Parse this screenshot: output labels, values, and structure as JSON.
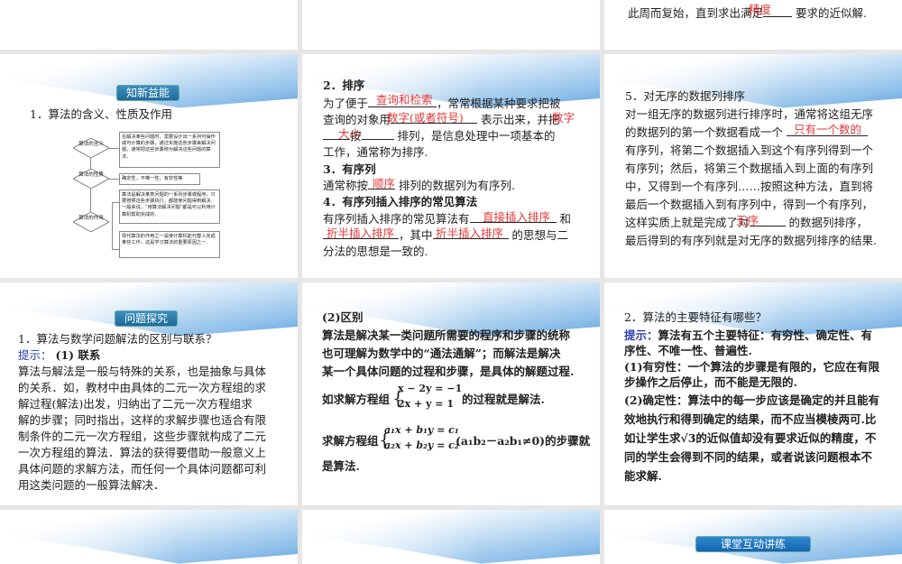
{
  "slides": {
    "top_right": {
      "line": "此周而复始，直到求出满足",
      "line_end": "要求的近似解.",
      "answer": "精度"
    },
    "s1": {
      "badge": "知新益能",
      "heading": "1．算法的含义、性质及作用",
      "diamonds": [
        "算法的含义",
        "算法的性质",
        "算法的作用"
      ],
      "boxes": [
        "在解决某些问题时，需要设计出一系列可操作或可计算的步骤，通过实施这些步骤来解决问题，通常把这些步骤称为解决这些问题的算法．",
        "确定性，不唯一性，有穷性等",
        "算法是解决某类问题的一系列步骤或程序，只要按照这些步骤执行，都能使问题得到解决．一般来说，“用算法解决问题”都是可以利用计算机帮助完成的．",
        "现代算法的作用之一是使计算机能代替人完成某些工作，这是学习算法的重要原因之一．"
      ]
    },
    "s2": {
      "h2": "2．排序",
      "l1a": "为了便于",
      "l1b": "，常常根据某种要求把被",
      "l2a": "查询的对象用",
      "l2b": "表示出来，并把",
      "l3a": "按",
      "l3b": "排列，是信息处理中一项基本的",
      "l4": "工作，通常称为排序.",
      "h3": "3．有序列",
      "l5a": "通常称按",
      "l5b": "排列的数据列为有序列.",
      "h4": "4．有序列插入排序的常见算法",
      "l6a": "有序列插入排序的常见算法有",
      "l6b": "和",
      "l7a": "，其中",
      "l7b": "的思想与二",
      "l8": "分法的思想是一致的.",
      "answers": [
        "查询和检索",
        "数字(或者符号)",
        "数字",
        "大小",
        "顺序",
        "直接插入排序",
        "折半插入排序",
        "折半插入排序"
      ]
    },
    "s3": {
      "h5": "5．对无序的数据列排序",
      "lines": [
        "对一组无序的数据列进行排序时，通常将这组无序",
        "的数据列的第一个数据看成一个",
        "有序列，将第二个数据插入到这个有序列得到一个",
        "有序列；然后，将第三个数据插入到上面的有序列",
        "中，又得到一个有序列……按照这种方法，直到将",
        "最后一个数据插入到有序列中，得到一个有序列，",
        "这样实质上就是完成了对",
        "的数据列排序，",
        "最后得到的有序列就是对无序的数据列排序的结果."
      ],
      "answers": [
        "只有一个数的",
        "无序"
      ]
    },
    "s4": {
      "badge": "问题探究",
      "q": "1．算法与数学问题解法的区别与联系？",
      "hint": "提示：",
      "hint_title": "(1) 联系",
      "lines": [
        "算法与解法是一般与特殊的关系，也是抽象与具体",
        "的关系．如，教材中由具体的二元一次方程组的求",
        "解过程(解法)出发，归纳出了二元一次方程组求",
        "解的步骤；同时指出，这样的求解步骤也适合有限",
        "制条件的二元一次方程组，这些步骤就构成了二元",
        "一次方程组的算法．算法的获得要借助一般意义上",
        "具体问题的求解方法，而任何一个具体问题都可利",
        "用这类问题的一般算法解决．"
      ]
    },
    "s5": {
      "title": "(2)区别",
      "lines": [
        "算法是解决某一类问题所需要的程序和步骤的统称",
        "也可理解为数学中的“通法通解”；而解法是解决",
        "某一个具体问题的过程和步骤，是具体的解题过程."
      ],
      "eq1_pre": "如求解方程组",
      "eq1": [
        "x − 2y = −1",
        "2x + y = 1"
      ],
      "eq1_post": "的过程就是解法.",
      "eq2_pre": "求解方程组",
      "eq2": [
        "a₁x + b₁y = c₁",
        "a₂x + b₂y = c₂"
      ],
      "eq2_post": "(a₁b₂－a₂b₁≠0)的步骤就",
      "eq2_end": "是算法."
    },
    "s6": {
      "q": "2．算法的主要特征有哪些？",
      "hint": "提示：",
      "lines": [
        "算法有五个主要特征：有穷性、确定性、有",
        "序性、不唯一性、普遍性.",
        "(1)有穷性：一个算法的步骤是有限的，它应在有限",
        "步操作之后停止，而不能是无限的.",
        "(2)确定性：算法中的每一步应该是确定的并且能有",
        "效地执行和得到确定的结果，而不应当模棱两可.比",
        "如让学生求√3的近似值却没有要求近似的精度，不",
        "同的学生会得到不同的结果，或者说该问题根本不",
        "能求解."
      ]
    },
    "s9": {
      "badge": "课堂互动讲练"
    }
  }
}
